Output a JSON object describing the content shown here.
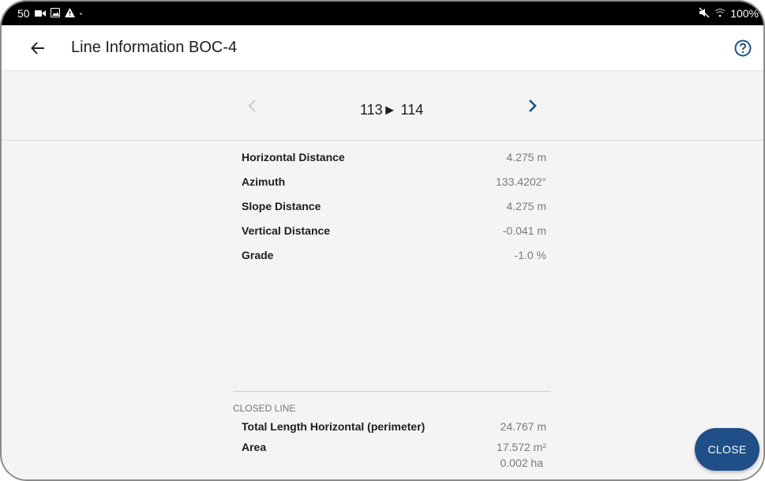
{
  "status_bar": {
    "time": "50",
    "battery": "100%",
    "left_icons": [
      "video-icon",
      "image-icon",
      "warning-icon"
    ],
    "right_icons": [
      "mute-icon",
      "wifi-icon"
    ]
  },
  "app_bar": {
    "title": "Line Information BOC-4",
    "back_icon": "arrow-left-icon",
    "help_icon": "help-circle-icon"
  },
  "navigation": {
    "segment_label": "113► 114",
    "prev_icon": "chevron-left-icon",
    "next_icon": "chevron-right-icon",
    "prev_enabled": false,
    "next_enabled": true
  },
  "measurements": [
    {
      "label": "Horizontal Distance",
      "value": "4.275 m"
    },
    {
      "label": "Azimuth",
      "value": "133.4202°"
    },
    {
      "label": "Slope Distance",
      "value": "4.275 m"
    },
    {
      "label": "Vertical Distance",
      "value": "-0.041 m"
    },
    {
      "label": "Grade",
      "value": "-1.0 %"
    }
  ],
  "closed_line": {
    "section_title": "CLOSED LINE",
    "total_length_label": "Total Length Horizontal (perimeter)",
    "total_length_value": "24.767 m",
    "area_label": "Area",
    "area_value": "17.572 m²",
    "area_value_ha": "0.002 ha"
  },
  "actions": {
    "close_label": "CLOSE"
  },
  "colors": {
    "primary": "#1f4f86",
    "next_chevron": "#1f4f86",
    "prev_chevron_disabled": "#c5ccd6",
    "value_text": "#7a7a7a"
  }
}
